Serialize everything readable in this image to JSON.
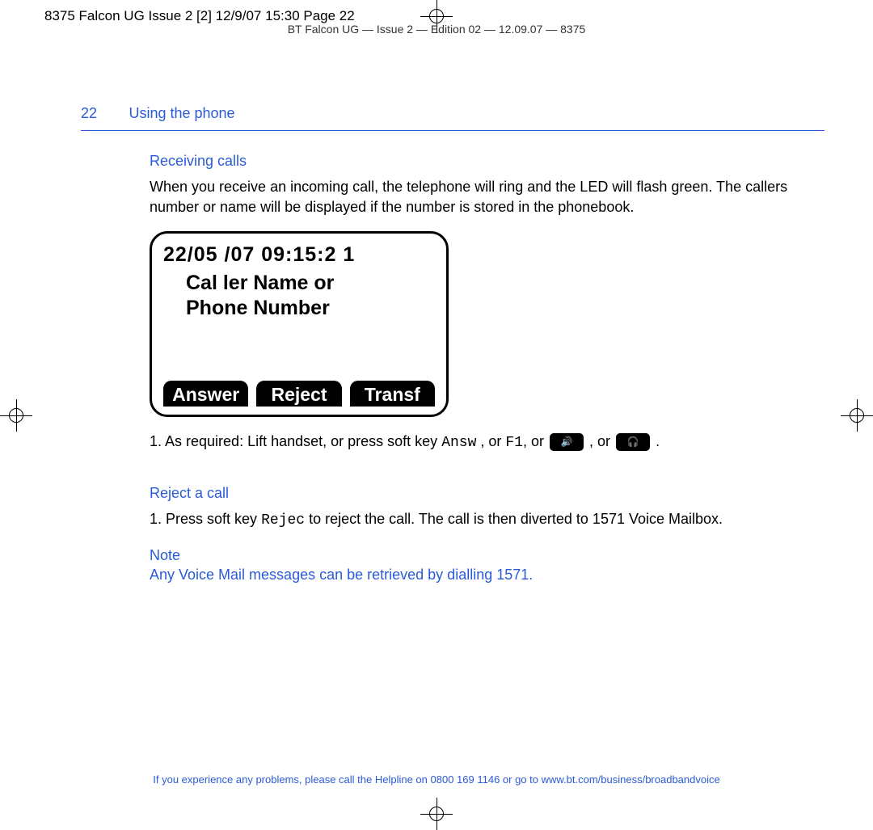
{
  "printers_mark": "8375 Falcon UG Issue 2 [2]  12/9/07  15:30  Page 22",
  "header_info": "BT Falcon UG — Issue 2 — Edition 02 — 12.09.07 — 8375",
  "page_number": "22",
  "section_title": "Using the phone",
  "receiving_calls_heading": "Receiving calls",
  "receiving_calls_para": "When you receive an incoming call, the telephone will ring and the LED will flash green. The callers number or name will be displayed if the number is stored in the phonebook.",
  "phone_display": {
    "datetime": "22/05 /07   09:15:2 1",
    "caller_line1": "Cal ler  Name or",
    "caller_line2": "Phone  Number",
    "softkeys": [
      "Answer",
      "Reject",
      "Transf"
    ]
  },
  "step1_prefix": "1. As required: Lift handset, or press soft key ",
  "step1_key1": "Answ",
  "step1_or1": " , or ",
  "step1_f1": "F1",
  "step1_or2": ", or ",
  "step1_or3": " , or ",
  "step1_period": " .",
  "reject_heading": "Reject a call",
  "reject_step_prefix": "1.  Press soft key ",
  "reject_key": "Rejec",
  "reject_step_suffix": " to reject the call. The call is then diverted to 1571 Voice Mailbox.",
  "note_label": "Note",
  "note_text": "Any Voice Mail messages can be retrieved by dialling 1571.",
  "footer": "If you experience any problems, please call the Helpline on 0800 169 1146 or go to www.bt.com/business/broadbandvoice"
}
